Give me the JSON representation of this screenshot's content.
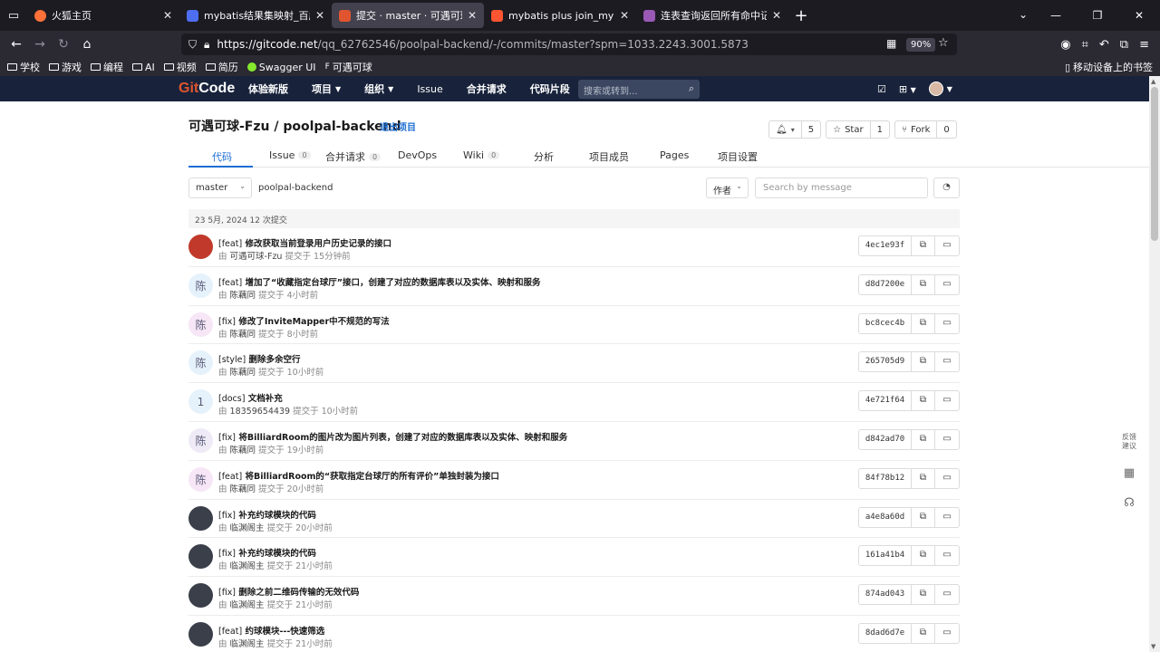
{
  "browser": {
    "tabs": [
      {
        "title": "火狐主页",
        "favicon_color": "#ff7139",
        "active": false
      },
      {
        "title": "mybatis结果集映射_百度搜索",
        "favicon_color": "#4e6ef2",
        "active": false
      },
      {
        "title": "提交 · master · 可遇可球-Fzu /",
        "favicon_color": "#e0552f",
        "active": true
      },
      {
        "title": "mybatis plus join_mybatis-pl",
        "favicon_color": "#fc5531",
        "active": false
      },
      {
        "title": "连表查询返回所有命中记录 | M",
        "favicon_color": "#9b59b6",
        "active": false
      }
    ],
    "url_domain": "https://gitcode.net",
    "url_path": "/qq_62762546/poolpal-backend/-/commits/master?spm=1033.2243.3001.5873",
    "zoom": "90%",
    "bookmarks": [
      "学校",
      "游戏",
      "编程",
      "AI",
      "视频",
      "简历",
      "Swagger UI",
      "可遇可球"
    ],
    "bookmarks_right": "移动设备上的书签"
  },
  "header": {
    "logo_prefix": "Git",
    "logo_suffix": "Code",
    "nav": [
      "体验新版",
      "项目",
      "组织",
      "Issue",
      "合并请求",
      "代码片段"
    ],
    "search_placeholder": "搜索或转到..."
  },
  "project": {
    "title": "可遇可球-Fzu / poolpal-backend",
    "exit": "退出项目",
    "notify_count": "5",
    "star_label": "Star",
    "star_count": "1",
    "fork_label": "Fork",
    "fork_count": "0",
    "tabs": [
      {
        "label": "代码",
        "badge": ""
      },
      {
        "label": "Issue",
        "badge": "0"
      },
      {
        "label": "合并请求",
        "badge": "0"
      },
      {
        "label": "DevOps",
        "badge": ""
      },
      {
        "label": "Wiki",
        "badge": "0"
      },
      {
        "label": "分析",
        "badge": ""
      },
      {
        "label": "项目成员",
        "badge": ""
      },
      {
        "label": "Pages",
        "badge": ""
      },
      {
        "label": "项目设置",
        "badge": ""
      }
    ]
  },
  "toolbar": {
    "branch": "master",
    "path": "poolpal-backend",
    "author": "作者",
    "search_placeholder": "Search by message"
  },
  "day_header": "23 5月, 2024 12 次提交",
  "commits": [
    {
      "tag": "[feat]",
      "msg": "修改获取当前登录用户历史记录的接口",
      "by": "由",
      "author": "可遇可球-Fzu",
      "time": "提交于 15分钟前",
      "hash": "4ec1e93f",
      "avatar": "",
      "avatar_bg": "#c0392b"
    },
    {
      "tag": "[feat]",
      "msg": "增加了“收藏指定台球厅”接口，创建了对应的数据库表以及实体、映射和服务",
      "by": "由",
      "author": "陈藕同",
      "time": "提交于 4小时前",
      "hash": "d8d7200e",
      "avatar": "陈",
      "avatar_bg": "#e6f2fb"
    },
    {
      "tag": "[fix]",
      "msg": "修改了InviteMapper中不规范的写法",
      "by": "由",
      "author": "陈藕同",
      "time": "提交于 8小时前",
      "hash": "bc8cec4b",
      "avatar": "陈",
      "avatar_bg": "#f6e6f6"
    },
    {
      "tag": "[style]",
      "msg": "删除多余空行",
      "by": "由",
      "author": "陈藕同",
      "time": "提交于 10小时前",
      "hash": "265705d9",
      "avatar": "陈",
      "avatar_bg": "#e6f2fb"
    },
    {
      "tag": "[docs]",
      "msg": "文档补充",
      "by": "由",
      "author": "18359654439",
      "time": "提交于 10小时前",
      "hash": "4e721f64",
      "avatar": "1",
      "avatar_bg": "#e6f2fb"
    },
    {
      "tag": "[fix]",
      "msg": "将BilliardRoom的图片改为图片列表，创建了对应的数据库表以及实体、映射和服务",
      "by": "由",
      "author": "陈藕同",
      "time": "提交于 19小时前",
      "hash": "d842ad70",
      "avatar": "陈",
      "avatar_bg": "#eeeaf6"
    },
    {
      "tag": "[feat]",
      "msg": "将BilliardRoom的“获取指定台球厅的所有评价”单独封装为接口",
      "by": "由",
      "author": "陈藕同",
      "time": "提交于 20小时前",
      "hash": "84f78b12",
      "avatar": "陈",
      "avatar_bg": "#f6e6f6"
    },
    {
      "tag": "[fix]",
      "msg": "补充约球模块的代码",
      "by": "由",
      "author": "临渊阁主",
      "time": "提交于 20小时前",
      "hash": "a4e8a60d",
      "avatar": "",
      "avatar_bg": "#3a3f4a"
    },
    {
      "tag": "[fix]",
      "msg": "补充约球模块的代码",
      "by": "由",
      "author": "临渊阁主",
      "time": "提交于 21小时前",
      "hash": "161a41b4",
      "avatar": "",
      "avatar_bg": "#3a3f4a"
    },
    {
      "tag": "[fix]",
      "msg": "删除之前二维码传输的无效代码",
      "by": "由",
      "author": "临渊阁主",
      "time": "提交于 21小时前",
      "hash": "874ad043",
      "avatar": "",
      "avatar_bg": "#3a3f4a"
    },
    {
      "tag": "[feat]",
      "msg": "约球模块---快速筛选",
      "by": "由",
      "author": "临渊阁主",
      "time": "提交于 21小时前",
      "hash": "8dad6d7e",
      "avatar": "",
      "avatar_bg": "#3a3f4a"
    }
  ],
  "float_tools": {
    "feedback": "反馈建议"
  }
}
